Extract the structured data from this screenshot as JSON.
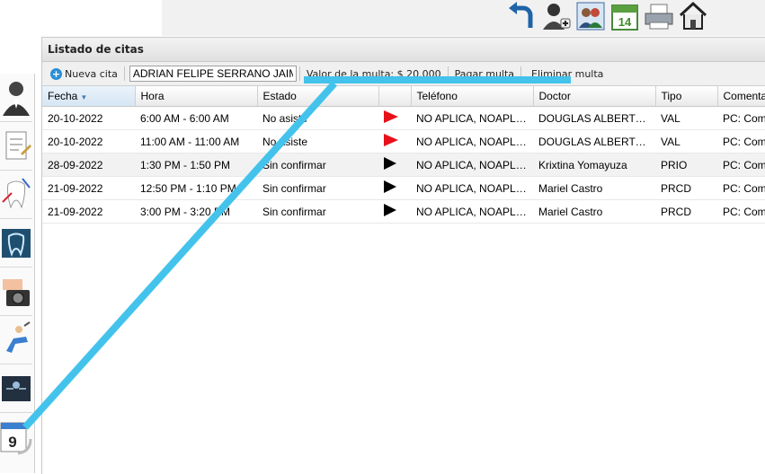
{
  "panel": {
    "title": "Listado de citas"
  },
  "toolbar": {
    "new_label": "Nueva cita",
    "patient_value": "ADRIAN FELIPE SERRANO JAIME",
    "fine_label": "Valor de la multa: $ 20.000",
    "pay_label": "Pagar multa",
    "delete_label": "Eliminar multa"
  },
  "table": {
    "headers": [
      "Fecha",
      "Hora",
      "Estado",
      "",
      "Teléfono",
      "Doctor",
      "Tipo",
      "Comentarios"
    ],
    "rows": [
      {
        "fecha": "20-10-2022",
        "hora": "6:00 AM - 6:00 AM",
        "estado": "No asiste",
        "flag": "#e8101a",
        "telefono": "NO APLICA, NOAPLICA",
        "doctor": "DOUGLAS ALBERTO CASTELLANOS",
        "tipo": "VAL",
        "comentario": "PC: Comentario"
      },
      {
        "fecha": "20-10-2022",
        "hora": "11:00 AM - 11:00 AM",
        "estado": "No asiste",
        "flag": "#e8101a",
        "telefono": "NO APLICA, NOAPLICA",
        "doctor": "DOUGLAS ALBERTO CASTELLANOS",
        "tipo": "VAL",
        "comentario": "PC: Comentario"
      },
      {
        "fecha": "28-09-2022",
        "hora": "1:30 PM - 1:50 PM",
        "estado": "Sin confirmar",
        "flag": "#000000",
        "telefono": "NO APLICA, NOAPLICA",
        "doctor": "Krixtina Yomayuza",
        "tipo": "PRIO",
        "comentario": "PC: Comentario"
      },
      {
        "fecha": "21-09-2022",
        "hora": "12:50 PM - 1:10 PM",
        "estado": "Sin confirmar",
        "flag": "#000000",
        "telefono": "NO APLICA, NOAPLICA",
        "doctor": "Mariel Castro",
        "tipo": "PRCD",
        "comentario": "PC: Comentario"
      },
      {
        "fecha": "21-09-2022",
        "hora": "3:00 PM - 3:20 PM",
        "estado": "Sin confirmar",
        "flag": "#000000",
        "telefono": "NO APLICA, NOAPLICA",
        "doctor": "Mariel Castro",
        "tipo": "PRCD",
        "comentario": "PC: Comentario"
      }
    ]
  },
  "top_icons": [
    {
      "name": "back-arrow-icon"
    },
    {
      "name": "add-user-icon"
    },
    {
      "name": "patients-icon"
    },
    {
      "name": "calendar-icon",
      "text": "14"
    },
    {
      "name": "printer-icon"
    },
    {
      "name": "home-icon"
    }
  ],
  "side_icons": [
    {
      "name": "doctor-icon"
    },
    {
      "name": "notes-icon"
    },
    {
      "name": "tooth-icon"
    },
    {
      "name": "tooth-xray-icon"
    },
    {
      "name": "camera-icon"
    },
    {
      "name": "dental-chair-icon"
    },
    {
      "name": "monitor-icon"
    },
    {
      "name": "calendar-back-icon",
      "text": "9"
    }
  ],
  "colors": {
    "annotation": "#43c3ec",
    "flag_red": "#e8101a",
    "flag_black": "#000000",
    "accent": "#2a8fd6"
  }
}
